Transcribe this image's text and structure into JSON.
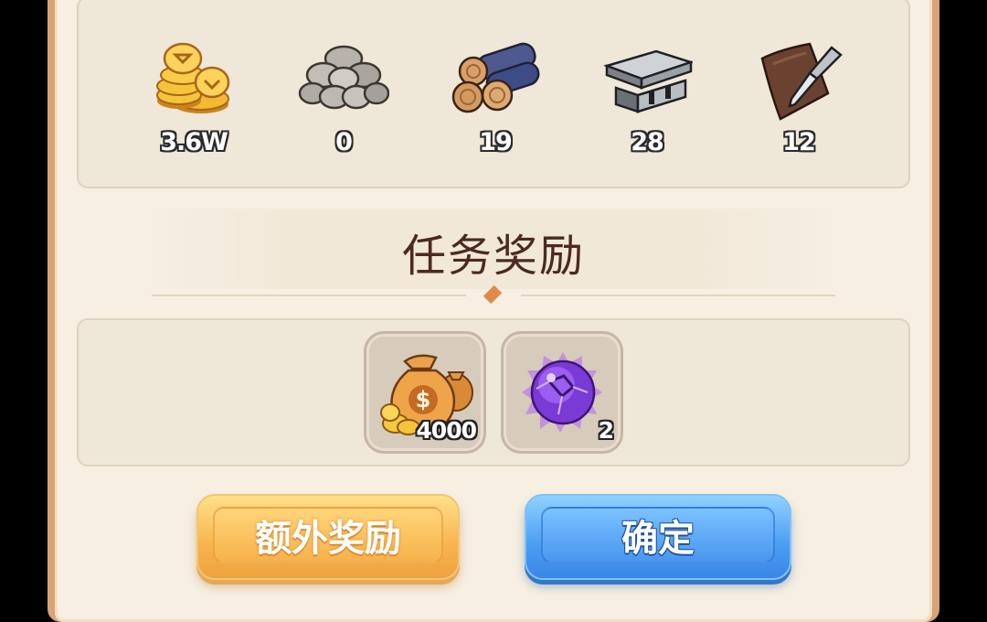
{
  "resources": [
    {
      "name": "gold-coins",
      "count": "3.6W"
    },
    {
      "name": "stone",
      "count": "0"
    },
    {
      "name": "wood",
      "count": "19"
    },
    {
      "name": "iron",
      "count": "28"
    },
    {
      "name": "leather",
      "count": "12"
    }
  ],
  "rewards_section": {
    "title": "任务奖励"
  },
  "rewards": [
    {
      "name": "money-bag",
      "count": "4000"
    },
    {
      "name": "purple-orb",
      "count": "2"
    }
  ],
  "buttons": {
    "extra_reward": "额外奖励",
    "confirm": "确定"
  }
}
